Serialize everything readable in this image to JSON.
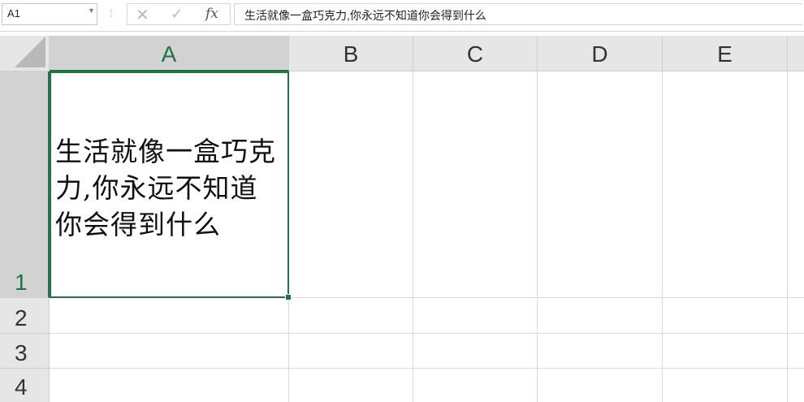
{
  "formula_bar": {
    "name_box": "A1",
    "name_box_arrow": "▾",
    "divider": "⁞",
    "cancel_symbol": "✕",
    "enter_symbol": "✓",
    "fx_label": "fx",
    "formula": "生活就像一盒巧克力,你永远不知道你会得到什么"
  },
  "columns": [
    "A",
    "B",
    "C",
    "D",
    "E"
  ],
  "rows": [
    "1",
    "2",
    "3",
    "4"
  ],
  "selection": {
    "column": "A",
    "row": "1"
  },
  "cells": {
    "A1": "生活就像一盒巧克力,你永远不知道你会得到什么"
  },
  "colors": {
    "accent": "#217346",
    "header_bg": "#e6e6e6",
    "selected_header_bg": "#d2d2d2",
    "gridline": "#dadada"
  }
}
